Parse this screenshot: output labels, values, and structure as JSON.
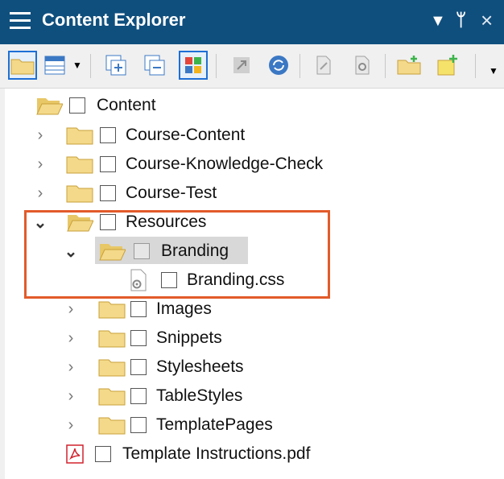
{
  "panel": {
    "title": "Content Explorer",
    "menu_icon": "hamburger-icon",
    "dropdown_icon": "triangle-down-icon",
    "pin_icon": "pin-icon",
    "close_icon": "close-icon"
  },
  "toolbar": {
    "buttons": [
      "folder-view-icon",
      "grid-view-icon",
      "expand-all-icon",
      "collapse-all-icon",
      "thumbnails-icon",
      "open-icon",
      "refresh-icon",
      "edit-file-icon",
      "properties-icon",
      "new-folder-icon",
      "new-item-icon"
    ]
  },
  "tree": {
    "root": "Content",
    "items": {
      "course_content": "Course-Content",
      "course_knowledge_check": "Course-Knowledge-Check",
      "course_test": "Course-Test",
      "resources": "Resources",
      "branding": "Branding",
      "branding_css": "Branding.css",
      "images": "Images",
      "snippets": "Snippets",
      "stylesheets": "Stylesheets",
      "tablestyles": "TableStyles",
      "templatepages": "TemplatePages",
      "template_pdf": "Template Instructions.pdf"
    }
  },
  "colors": {
    "titlebar": "#0f4f7e",
    "highlight_border": "#e25b2a",
    "folder": "#f4d98a",
    "selected_row": "#d8d8d8"
  }
}
